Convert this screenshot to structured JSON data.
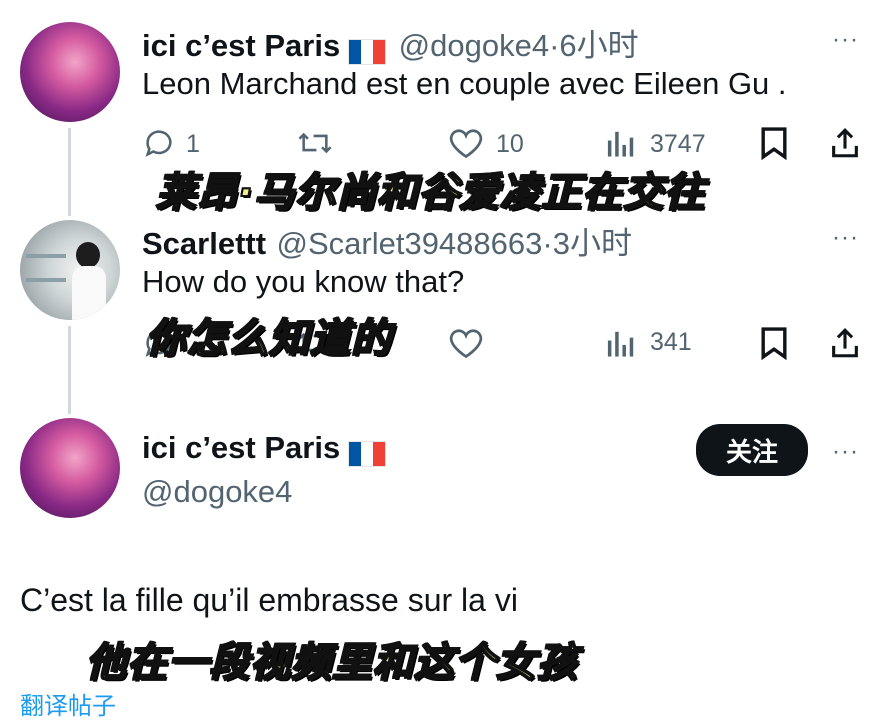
{
  "post1": {
    "name": "ici c’est Paris",
    "handle": "@dogoke4",
    "time": "·6小时",
    "text": "Leon Marchand est en couple avec Eileen Gu .",
    "subtitle": "莱昂·马尔尚和谷爱凌正在交往",
    "replies": "1",
    "likes": "10",
    "views": "3747",
    "more": "···"
  },
  "post2": {
    "name": "Scarlettt",
    "handle": "@Scarlet39488663",
    "time": "·3小时",
    "text": "How do you know that?",
    "subtitle": "你怎么知道的",
    "views": "341",
    "more": "···"
  },
  "post3": {
    "name": "ici c’est Paris",
    "handle": "@dogoke4",
    "follow_label": "关注",
    "text": "C’est la fille qu’il embrasse sur la vi",
    "subtitle": "他在一段视频里和这个女孩",
    "translate_label": "翻译帖子",
    "more": "···"
  },
  "colors": {
    "text_primary": "#0f1419",
    "text_secondary": "#536471",
    "link_blue": "#1d9bf0",
    "subtitle_yellow": "#f6f08a"
  }
}
